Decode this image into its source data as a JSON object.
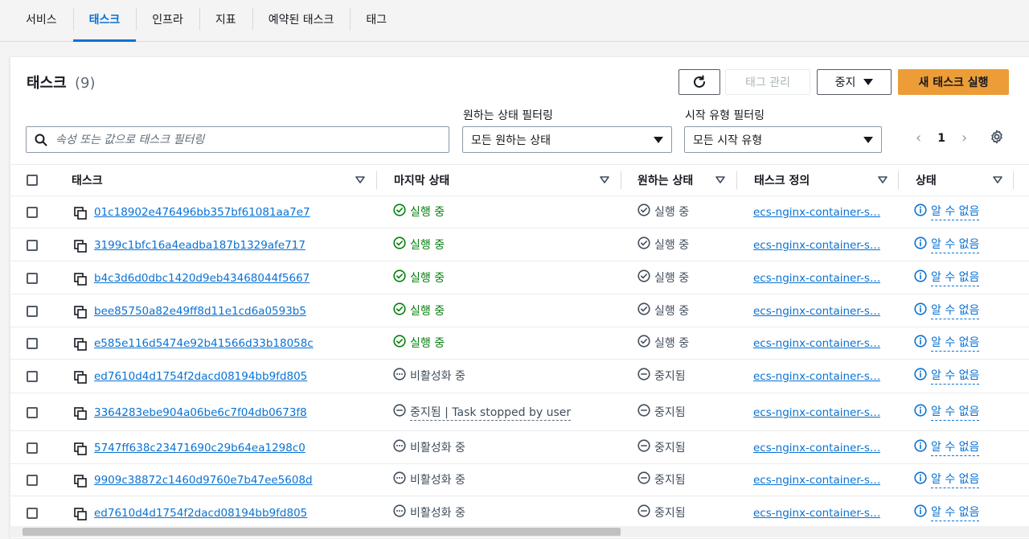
{
  "top_tabs": [
    {
      "label": "서비스",
      "active": false
    },
    {
      "label": "태스크",
      "active": true
    },
    {
      "label": "인프라",
      "active": false
    },
    {
      "label": "지표",
      "active": false
    },
    {
      "label": "예약된 태스크",
      "active": false
    },
    {
      "label": "태그",
      "active": false
    }
  ],
  "panel": {
    "title": "태스크",
    "count": "(9)",
    "buttons": {
      "refresh_icon": "refresh-icon",
      "manage_tags": "태그 관리",
      "stop": "중지",
      "run_task": "새 태스크 실행"
    },
    "search": {
      "placeholder": "속성 또는 값으로 태스크 필터링",
      "value": ""
    },
    "desired_filter": {
      "label": "원하는 상태 필터링",
      "selected": "모든 원하는 상태"
    },
    "launch_filter": {
      "label": "시작 유형 필터링",
      "selected": "모든 시작 유형"
    },
    "pagination": {
      "current": "1",
      "prev": "‹",
      "next": "›"
    }
  },
  "table": {
    "columns": [
      "태스크",
      "마지막 상태",
      "원하는 상태",
      "태스크 정의",
      "상태"
    ],
    "rows": [
      {
        "task": "01c18902e476496bb357bf61081aa7e7",
        "last": "실행 중",
        "last_type": "ok",
        "desired": "실행 중",
        "desired_type": "ok",
        "def": "ecs-nginx-container-s…",
        "health": "알 수 없음"
      },
      {
        "task": "3199c1bfc16a4eadba187b1329afe717",
        "last": "실행 중",
        "last_type": "ok",
        "desired": "실행 중",
        "desired_type": "ok",
        "def": "ecs-nginx-container-s…",
        "health": "알 수 없음"
      },
      {
        "task": "b4c3d6d0dbc1420d9eb43468044f5667",
        "last": "실행 중",
        "last_type": "ok",
        "desired": "실행 중",
        "desired_type": "ok",
        "def": "ecs-nginx-container-s…",
        "health": "알 수 없음"
      },
      {
        "task": "bee85750a82e49ff8d11e1cd6a0593b5",
        "last": "실행 중",
        "last_type": "ok",
        "desired": "실행 중",
        "desired_type": "ok",
        "def": "ecs-nginx-container-s…",
        "health": "알 수 없음"
      },
      {
        "task": "e585e116d5474e92b41566d33b18058c",
        "last": "실행 중",
        "last_type": "ok",
        "desired": "실행 중",
        "desired_type": "ok",
        "def": "ecs-nginx-container-s…",
        "health": "알 수 없음"
      },
      {
        "task": "ed7610d4d1754f2dacd08194bb9fd805",
        "last": "비활성화 중",
        "last_type": "pending",
        "desired": "중지됨",
        "desired_type": "stopped",
        "def": "ecs-nginx-container-s…",
        "health": "알 수 없음"
      },
      {
        "task": "3364283ebe904a06be6c7f04db0673f8",
        "last": "중지됨 | Task stopped by user",
        "last_type": "stopped",
        "desired": "중지됨",
        "desired_type": "stopped",
        "def": "ecs-nginx-container-s…",
        "health": "알 수 없음"
      },
      {
        "task": "5747ff638c23471690c29b64ea1298c0",
        "last": "비활성화 중",
        "last_type": "pending",
        "desired": "중지됨",
        "desired_type": "stopped",
        "def": "ecs-nginx-container-s…",
        "health": "알 수 없음"
      },
      {
        "task": "9909c38872c1460d9760e7b47ee5608d",
        "last": "비활성화 중",
        "last_type": "pending",
        "desired": "중지됨",
        "desired_type": "stopped",
        "def": "ecs-nginx-container-s…",
        "health": "알 수 없음"
      },
      {
        "task": "ed7610d4d1754f2dacd08194bb9fd805",
        "last": "비활성화 중",
        "last_type": "pending",
        "desired": "중지됨",
        "desired_type": "stopped",
        "def": "ecs-nginx-container-s…",
        "health": "알 수 없음"
      }
    ]
  },
  "colors": {
    "accent": "#0972d3",
    "success": "#037f0c",
    "primary_button": "#ec9d37"
  }
}
